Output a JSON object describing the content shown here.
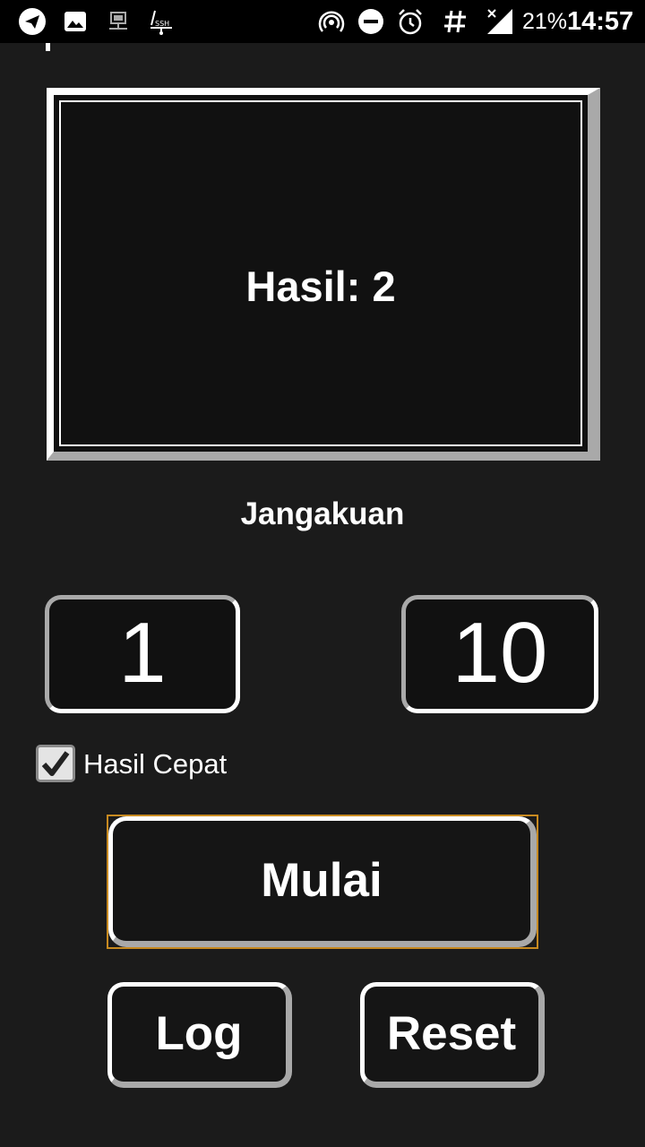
{
  "status_bar": {
    "icons": [
      "telegram-icon",
      "gallery-icon",
      "network-icon",
      "ssh-icon",
      "hotspot-icon",
      "do-not-disturb-icon",
      "alarm-icon",
      "hash-icon",
      "signal-icon"
    ],
    "battery": "21%",
    "time": "14:57"
  },
  "result": {
    "text": "Hasil: 2"
  },
  "range": {
    "title": "Jangakuan",
    "min": "1",
    "max": "10"
  },
  "options": {
    "fast_result_label": "Hasil Cepat",
    "fast_result_checked": true
  },
  "buttons": {
    "start": "Mulai",
    "log": "Log",
    "reset": "Reset"
  }
}
